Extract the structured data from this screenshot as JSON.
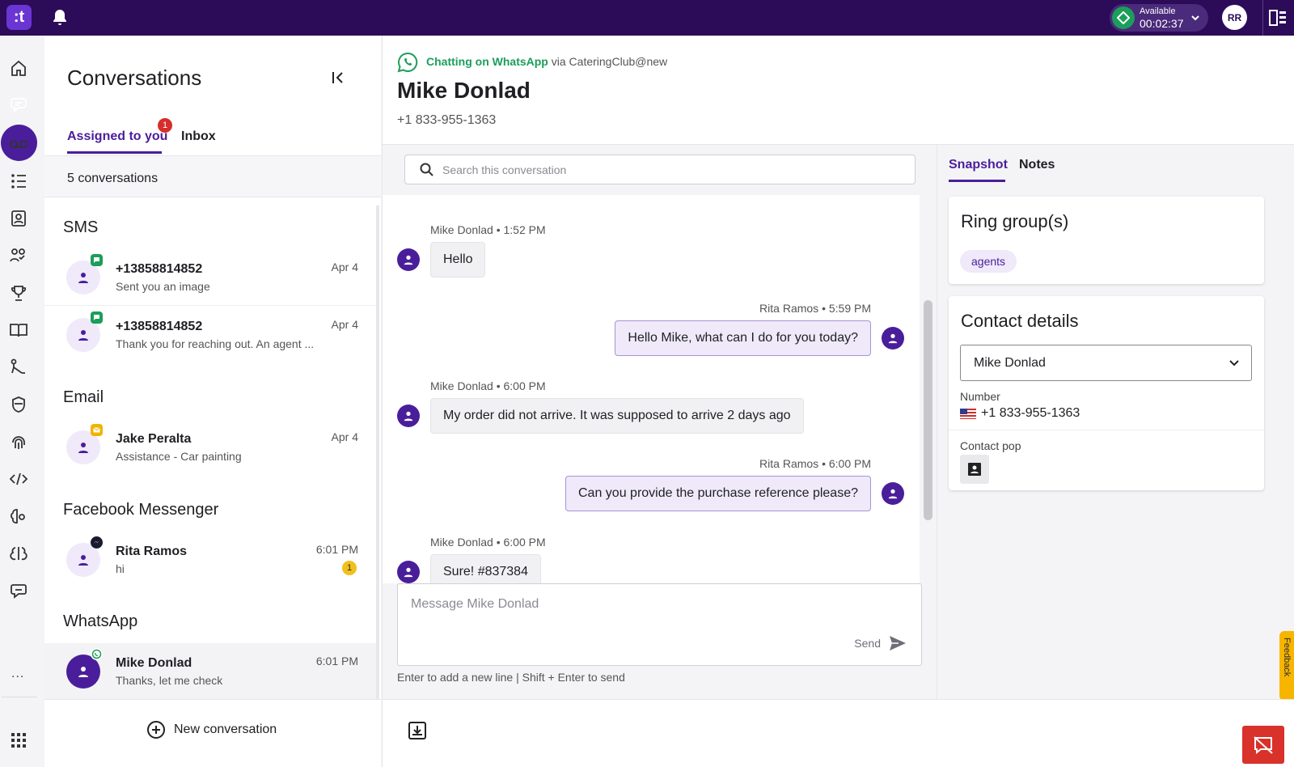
{
  "topbar": {
    "logo_text": ":t",
    "status_label": "Available",
    "status_timer": "00:02:37",
    "status_color": "#1b9e5a",
    "user_initials": "RR"
  },
  "rail": {
    "items": [
      "home-icon",
      "conversations-icon",
      "voicemail-icon",
      "queue-list-icon",
      "contacts-icon",
      "team-icon",
      "trophy-icon",
      "book-icon",
      "routing-icon",
      "shield-icon",
      "fingerprint-icon",
      "code-icon",
      "brain-settings-icon",
      "ai-brain-icon",
      "chat-bubble-icon"
    ],
    "more_label": "..."
  },
  "conversations": {
    "title": "Conversations",
    "tabs": {
      "assigned": "Assigned to you",
      "assigned_badge": "1",
      "inbox": "Inbox"
    },
    "count_text": "5 conversations",
    "groups": [
      {
        "title": "SMS",
        "items": [
          {
            "name": "+13858814852",
            "preview": "Sent you an image",
            "date": "Apr 4",
            "channel": "sms"
          },
          {
            "name": "+13858814852",
            "preview": "Thank you for reaching out. An agent ...",
            "date": "Apr 4",
            "channel": "sms"
          }
        ]
      },
      {
        "title": "Email",
        "items": [
          {
            "name": "Jake Peralta",
            "preview": "Assistance - Car painting",
            "date": "Apr 4",
            "channel": "email"
          }
        ]
      },
      {
        "title": "Facebook Messenger",
        "items": [
          {
            "name": "Rita Ramos",
            "preview": "hi",
            "date": "6:01 PM",
            "unread": "1",
            "channel": "messenger"
          }
        ]
      },
      {
        "title": "WhatsApp",
        "items": [
          {
            "name": "Mike Donlad",
            "preview": "Thanks, let me check",
            "date": "6:01 PM",
            "channel": "whatsapp"
          }
        ]
      }
    ],
    "new_conversation": "New conversation"
  },
  "chat": {
    "channel_text": "Chatting on WhatsApp",
    "via_text": "via CateringClub@new",
    "contact_name": "Mike Donlad",
    "contact_number": "+1 833-955-1363",
    "search_placeholder": "Search this conversation",
    "messages": [
      {
        "meta": "Mike Donlad • 1:52 PM",
        "text": "Hello",
        "direction": "in"
      },
      {
        "meta": "Rita Ramos • 5:59 PM",
        "text": "Hello Mike, what can I do for you today?",
        "direction": "out"
      },
      {
        "meta": "Mike Donlad • 6:00 PM",
        "text": "My order did not arrive. It was supposed to arrive 2 days ago",
        "direction": "in"
      },
      {
        "meta": "Rita Ramos • 6:00 PM",
        "text": "Can you provide the purchase reference please?",
        "direction": "out"
      },
      {
        "meta": "Mike Donlad • 6:00 PM",
        "text": "Sure! #837384",
        "direction": "in"
      }
    ],
    "composer_placeholder": "Message Mike Donlad",
    "send_label": "Send",
    "hint": "Enter to add a new line | Shift + Enter to send"
  },
  "right": {
    "tabs": {
      "snapshot": "Snapshot",
      "notes": "Notes"
    },
    "ring_groups_title": "Ring group(s)",
    "ring_group_chip": "agents",
    "contact_details_title": "Contact details",
    "contact_select": "Mike Donlad",
    "number_label": "Number",
    "number_value": "+1 833-955-1363",
    "contact_pop_label": "Contact pop",
    "feedback_label": "Feedback"
  },
  "colors": {
    "brand": "#2c0c58",
    "accent": "#4a1e9a",
    "whatsapp": "#1b9e5a",
    "danger": "#d8322b"
  }
}
